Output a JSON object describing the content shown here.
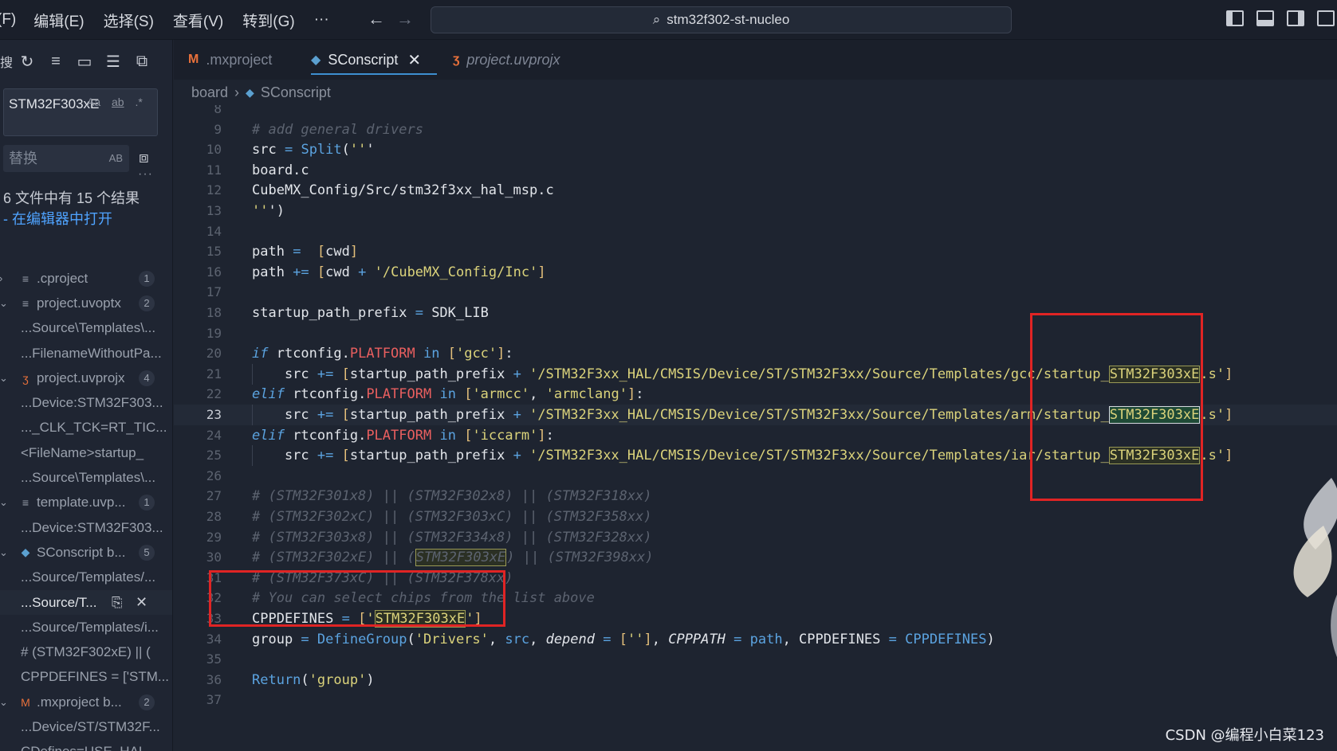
{
  "menu": [
    "(F)",
    "编辑(E)",
    "选择(S)",
    "查看(V)",
    "转到(G)",
    "···"
  ],
  "command_center": "stm32f302-st-nucleo",
  "sidebar": {
    "toolbar_first": "搜",
    "find_text": "STM32F303xE",
    "find_opts": [
      "Aa",
      "ab",
      ".*"
    ],
    "replace_placeholder": "替换",
    "replace_opt": "AB",
    "more": "···",
    "result_summary": "6 文件中有 15 个结果",
    "open_in_editor": "- 在编辑器中打开",
    "tree": [
      {
        "kind": "file",
        "chev": "›",
        "icon": "≡",
        "icon_color": "#9aa1ad",
        "name": ".cproject",
        "badge": "1"
      },
      {
        "kind": "file",
        "chev": "⌄",
        "icon": "≡",
        "icon_color": "#9aa1ad",
        "name": "project.uvoptx",
        "badge": "2"
      },
      {
        "kind": "match",
        "text": "...Source\\Templates\\..."
      },
      {
        "kind": "match",
        "text": "...FilenameWithoutPa..."
      },
      {
        "kind": "file",
        "chev": "⌄",
        "icon": "ʒ",
        "icon_color": "#e9713b",
        "name": "project.uvprojx",
        "badge": "4"
      },
      {
        "kind": "match",
        "text": "...Device:STM32F303..."
      },
      {
        "kind": "match",
        "text": "..._CLK_TCK=RT_TIC..."
      },
      {
        "kind": "match",
        "text": "<FileName>startup_"
      },
      {
        "kind": "match",
        "text": "...Source\\Templates\\..."
      },
      {
        "kind": "file",
        "chev": "⌄",
        "icon": "≡",
        "icon_color": "#9aa1ad",
        "name": "template.uvp...",
        "badge": "1"
      },
      {
        "kind": "match",
        "text": "...Device:STM32F303..."
      },
      {
        "kind": "file",
        "chev": "⌄",
        "icon": "◆",
        "icon_color": "#5ba0d0",
        "name": "SConscript b...",
        "badge": "5"
      },
      {
        "kind": "match",
        "text": "...Source/Templates/..."
      },
      {
        "kind": "match-active",
        "text": "...Source/T..."
      },
      {
        "kind": "match",
        "text": "...Source/Templates/i..."
      },
      {
        "kind": "match",
        "text": "# (STM32F302xE) || ("
      },
      {
        "kind": "match",
        "text": "CPPDEFINES = ['STM..."
      },
      {
        "kind": "file",
        "chev": "⌄",
        "icon": "M",
        "icon_color": "#e9713b",
        "name": ".mxproject b...",
        "badge": "2"
      },
      {
        "kind": "match",
        "text": "...Device/ST/STM32F..."
      },
      {
        "kind": "match",
        "text": "CDefines=USE_HAL_..."
      }
    ]
  },
  "tabs": [
    {
      "label": ".mxproject",
      "icon": "M"
    },
    {
      "label": "SConscript",
      "icon": "◆",
      "close": "✕"
    },
    {
      "label": "project.uvprojx",
      "icon": "ʒ"
    }
  ],
  "breadcrumb": [
    "board",
    "SConscript"
  ],
  "editor": {
    "first_line": 8,
    "current_line": 23,
    "lines": [
      "",
      "# add general drivers",
      "src = Split('''",
      "board.c",
      "CubeMX_Config/Src/stm32f3xx_hal_msp.c",
      "''')",
      "",
      "path =  [cwd]",
      "path += [cwd + '/CubeMX_Config/Inc']",
      "",
      "startup_path_prefix = SDK_LIB",
      "",
      "if rtconfig.PLATFORM in ['gcc']:",
      "    src += [startup_path_prefix + '/STM32F3xx_HAL/CMSIS/Device/ST/STM32F3xx/Source/Templates/gcc/startup_STM32F303xE.s']",
      "elif rtconfig.PLATFORM in ['armcc', 'armclang']:",
      "    src += [startup_path_prefix + '/STM32F3xx_HAL/CMSIS/Device/ST/STM32F3xx/Source/Templates/arm/startup_STM32F303xE.s']",
      "elif rtconfig.PLATFORM in ['iccarm']:",
      "    src += [startup_path_prefix + '/STM32F3xx_HAL/CMSIS/Device/ST/STM32F3xx/Source/Templates/iar/startup_STM32F303xE.s']",
      "",
      "# (STM32F301x8) || (STM32F302x8) || (STM32F318xx)",
      "# (STM32F302xC) || (STM32F303xC) || (STM32F358xx)",
      "# (STM32F303x8) || (STM32F334x8) || (STM32F328xx)",
      "# (STM32F302xE) || (STM32F303xE) || (STM32F398xx)",
      "# (STM32F373xC) || (STM32F378xx)",
      "# You can select chips from the list above",
      "CPPDEFINES = ['STM32F303xE']",
      "group = DefineGroup('Drivers', src, depend = [''], CPPPATH = path, CPPDEFINES = CPPDEFINES)",
      "",
      "Return('group')",
      ""
    ]
  },
  "watermark": "CSDN @编程小白菜123",
  "colors": {
    "annotation": "#e02424",
    "accent": "#3d8fd0"
  }
}
